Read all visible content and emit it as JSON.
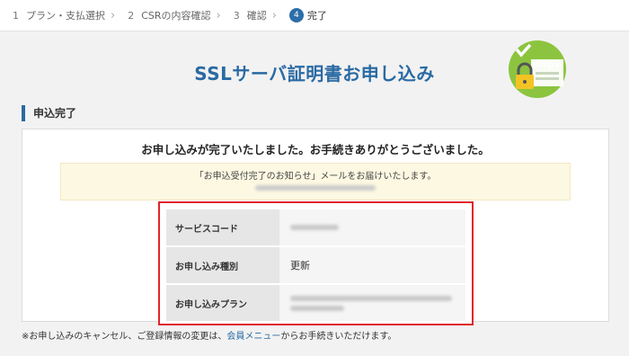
{
  "steps": [
    {
      "num": "1",
      "label": "プラン・支払選択"
    },
    {
      "num": "2",
      "label": "CSRの内容確認"
    },
    {
      "num": "3",
      "label": "確認"
    },
    {
      "num": "4",
      "label": "完了"
    }
  ],
  "header": {
    "title": "SSLサーバ証明書お申し込み",
    "badge_text": "https"
  },
  "section": {
    "title": "申込完了"
  },
  "main": {
    "complete_message": "お申し込みが完了いたしました。お手続きありがとうございました。",
    "notice": "「お申込受付完了のお知らせ」メールをお届けいたします。",
    "rows": [
      {
        "label": "サービスコード",
        "value": ""
      },
      {
        "label": "お申し込み種別",
        "value": "更新"
      },
      {
        "label": "お申し込みプラン",
        "value": ""
      }
    ]
  },
  "footer": {
    "note_prefix": "※お申し込みのキャンセル、ご登録情報の変更は、",
    "link_text": "会員メニュー",
    "note_suffix": "からお手続きいただけます。"
  },
  "colors": {
    "accent": "#2a6aa3",
    "highlight_border": "#e0252b",
    "notice_bg": "#fdf8e2",
    "badge_green": "#8cc43f"
  }
}
